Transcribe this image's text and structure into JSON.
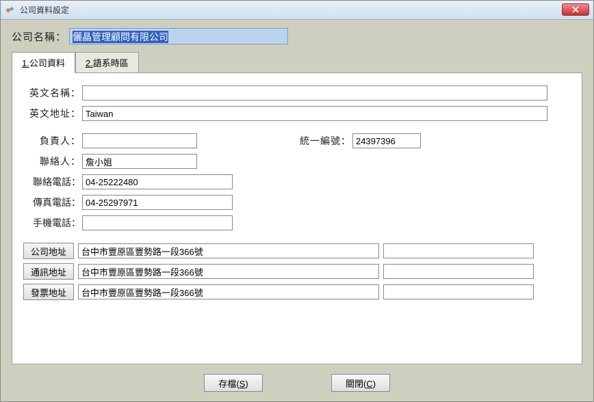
{
  "window": {
    "title": "公司資料設定"
  },
  "header": {
    "company_name_label": "公司名稱：",
    "company_name_value": "儷晶管理顧問有限公司"
  },
  "tabs": {
    "tab1_accel": "1.",
    "tab1_label": "公司資料",
    "tab2_accel": "2.",
    "tab2_label": "語系時區"
  },
  "form": {
    "eng_name_label": "英文名稱：",
    "eng_name_value": "",
    "eng_addr_label": "英文地址：",
    "eng_addr_value": "Taiwan",
    "owner_label": "負責人：",
    "owner_value": "",
    "tax_id_label": "統一編號：",
    "tax_id_value": "24397396",
    "contact_label": "聯絡人：",
    "contact_value": "詹小姐",
    "phone_label": "聯絡電話：",
    "phone_value": "04-25222480",
    "fax_label": "傳真電話：",
    "fax_value": "04-25297971",
    "mobile_label": "手機電話：",
    "mobile_value": ""
  },
  "addresses": {
    "company_btn": "公司地址",
    "company_line1": "台中市豐原區豐勢路一段366號",
    "company_line2": "",
    "mailing_btn": "通訊地址",
    "mailing_line1": "台中市豐原區豐勢路一段366號",
    "mailing_line2": "",
    "invoice_btn": "發票地址",
    "invoice_line1": "台中市豐原區豐勢路一段366號",
    "invoice_line2": ""
  },
  "buttons": {
    "save_label": "存檔(",
    "save_accel": "S",
    "save_suffix": ")",
    "close_label": "關閉(",
    "close_accel": "C",
    "close_suffix": ")"
  }
}
